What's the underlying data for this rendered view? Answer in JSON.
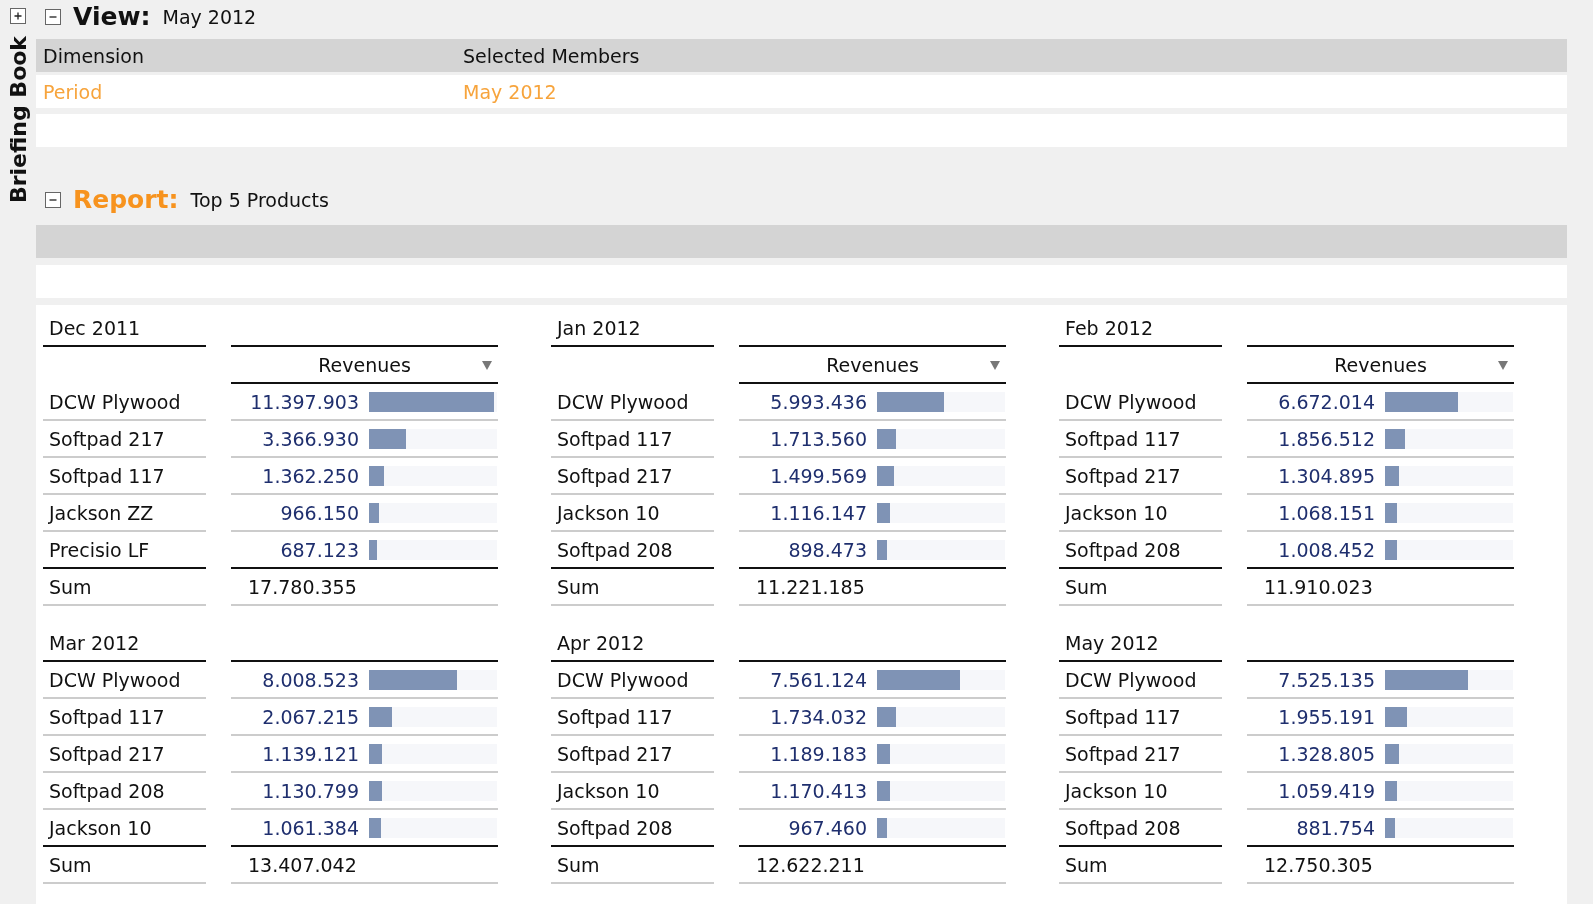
{
  "sidebar": {
    "title": "Briefing Book",
    "expanded": false
  },
  "view": {
    "label": "View:",
    "value": "May 2012",
    "expanded": true,
    "table": {
      "columns": [
        "Dimension",
        "Selected Members"
      ],
      "rows": [
        {
          "dimension": "Period",
          "members": "May 2012"
        }
      ]
    }
  },
  "report": {
    "label": "Report:",
    "value": "Top 5 Products",
    "expanded": true
  },
  "panels": [
    {
      "title": "Dec 2011",
      "column_header": "Revenues",
      "rows": [
        {
          "product": "DCW Plywood",
          "value": "11.397.903",
          "level": 0.98
        },
        {
          "product": "Softpad 217",
          "value": "3.366.930",
          "level": 0.29
        },
        {
          "product": "Softpad 117",
          "value": "1.362.250",
          "level": 0.12
        },
        {
          "product": "Jackson ZZ",
          "value": "966.150",
          "level": 0.08
        },
        {
          "product": "Precisio LF",
          "value": "687.123",
          "level": 0.06
        }
      ],
      "sum_label": "Sum",
      "sum": "17.780.355"
    },
    {
      "title": "Jan 2012",
      "column_header": "Revenues",
      "rows": [
        {
          "product": "DCW Plywood",
          "value": "5.993.436",
          "level": 0.52
        },
        {
          "product": "Softpad 117",
          "value": "1.713.560",
          "level": 0.15
        },
        {
          "product": "Softpad 217",
          "value": "1.499.569",
          "level": 0.13
        },
        {
          "product": "Jackson 10",
          "value": "1.116.147",
          "level": 0.1
        },
        {
          "product": "Softpad 208",
          "value": "898.473",
          "level": 0.08
        }
      ],
      "sum_label": "Sum",
      "sum": "11.221.185"
    },
    {
      "title": "Feb 2012",
      "column_header": "Revenues",
      "rows": [
        {
          "product": "DCW Plywood",
          "value": "6.672.014",
          "level": 0.57
        },
        {
          "product": "Softpad 117",
          "value": "1.856.512",
          "level": 0.16
        },
        {
          "product": "Softpad 217",
          "value": "1.304.895",
          "level": 0.11
        },
        {
          "product": "Jackson 10",
          "value": "1.068.151",
          "level": 0.09
        },
        {
          "product": "Softpad 208",
          "value": "1.008.452",
          "level": 0.09
        }
      ],
      "sum_label": "Sum",
      "sum": "11.910.023"
    },
    {
      "title": "Mar 2012",
      "rows": [
        {
          "product": "DCW Plywood",
          "value": "8.008.523",
          "level": 0.69
        },
        {
          "product": "Softpad 117",
          "value": "2.067.215",
          "level": 0.18
        },
        {
          "product": "Softpad 217",
          "value": "1.139.121",
          "level": 0.1
        },
        {
          "product": "Softpad 208",
          "value": "1.130.799",
          "level": 0.1
        },
        {
          "product": "Jackson 10",
          "value": "1.061.384",
          "level": 0.09
        }
      ],
      "sum_label": "Sum",
      "sum": "13.407.042"
    },
    {
      "title": "Apr 2012",
      "rows": [
        {
          "product": "DCW Plywood",
          "value": "7.561.124",
          "level": 0.65
        },
        {
          "product": "Softpad 117",
          "value": "1.734.032",
          "level": 0.15
        },
        {
          "product": "Softpad 217",
          "value": "1.189.183",
          "level": 0.1
        },
        {
          "product": "Jackson 10",
          "value": "1.170.413",
          "level": 0.1
        },
        {
          "product": "Softpad 208",
          "value": "967.460",
          "level": 0.08
        }
      ],
      "sum_label": "Sum",
      "sum": "12.622.211"
    },
    {
      "title": "May 2012",
      "rows": [
        {
          "product": "DCW Plywood",
          "value": "7.525.135",
          "level": 0.65
        },
        {
          "product": "Softpad 117",
          "value": "1.955.191",
          "level": 0.17
        },
        {
          "product": "Softpad 217",
          "value": "1.328.805",
          "level": 0.11
        },
        {
          "product": "Jackson 10",
          "value": "1.059.419",
          "level": 0.09
        },
        {
          "product": "Softpad 208",
          "value": "881.754",
          "level": 0.08
        }
      ],
      "sum_label": "Sum",
      "sum": "12.750.305"
    }
  ]
}
